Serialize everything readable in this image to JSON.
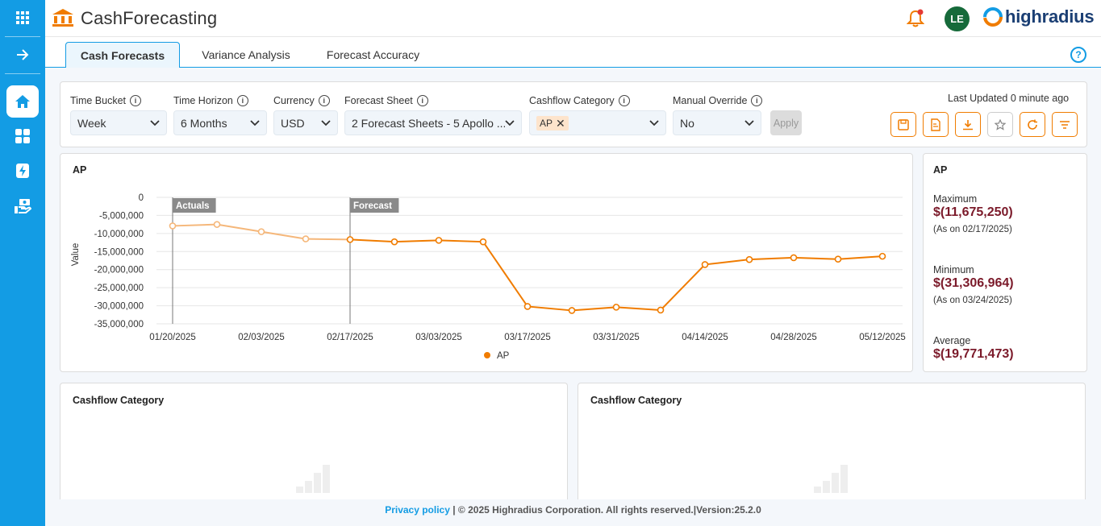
{
  "app": {
    "title": "CashForecasting",
    "brand_logo_text": "highradius",
    "avatar_initials": "LE"
  },
  "sidebar": {
    "items": [
      {
        "name": "apps-grid-icon"
      },
      {
        "name": "expand-arrow-icon"
      },
      {
        "name": "home-icon",
        "active": true
      },
      {
        "name": "dashboard-icon"
      },
      {
        "name": "bolt-icon"
      },
      {
        "name": "cash-hand-icon"
      }
    ]
  },
  "tabs": [
    {
      "label": "Cash Forecasts",
      "active": true
    },
    {
      "label": "Variance Analysis"
    },
    {
      "label": "Forecast Accuracy"
    }
  ],
  "filters": {
    "time_bucket": {
      "label": "Time Bucket",
      "value": "Week"
    },
    "time_horizon": {
      "label": "Time Horizon",
      "value": "6 Months"
    },
    "currency": {
      "label": "Currency",
      "value": "USD"
    },
    "forecast_sheet": {
      "label": "Forecast Sheet",
      "value": "2 Forecast Sheets - 5 Apollo ..."
    },
    "cashflow_category": {
      "label": "Cashflow Category",
      "chip": "AP"
    },
    "manual_override": {
      "label": "Manual Override",
      "value": "No"
    },
    "apply_label": "Apply",
    "last_updated": "Last Updated 0 minute ago"
  },
  "toolbar_icons": [
    "save-icon",
    "pdf-icon",
    "download-icon",
    "star-icon",
    "refresh-icon",
    "filter-icon"
  ],
  "chart_card": {
    "title": "AP"
  },
  "chart_data": {
    "type": "line",
    "title": "AP",
    "ylabel": "Value",
    "xlabel": "",
    "ylim": [
      -35000000,
      0
    ],
    "yticks": [
      0,
      -5000000,
      -10000000,
      -15000000,
      -20000000,
      -25000000,
      -30000000,
      -35000000
    ],
    "ytick_labels": [
      "0",
      "-5,000,000",
      "-10,000,000",
      "-15,000,000",
      "-20,000,000",
      "-25,000,000",
      "-30,000,000",
      "-35,000,000"
    ],
    "xtick_labels": [
      "01/20/2025",
      "02/03/2025",
      "02/17/2025",
      "03/03/2025",
      "03/17/2025",
      "03/31/2025",
      "04/14/2025",
      "04/28/2025",
      "05/12/2025"
    ],
    "x": [
      "01/20/2025",
      "01/27/2025",
      "02/03/2025",
      "02/10/2025",
      "02/17/2025",
      "02/24/2025",
      "03/03/2025",
      "03/10/2025",
      "03/17/2025",
      "03/24/2025",
      "03/31/2025",
      "04/07/2025",
      "04/14/2025",
      "04/21/2025",
      "04/28/2025",
      "05/05/2025",
      "05/12/2025"
    ],
    "series": [
      {
        "name": "AP",
        "color": "#f07c00",
        "actuals_color": "#f5b77a",
        "values": [
          -7900000,
          -7500000,
          -9500000,
          -11500000,
          -11675250,
          -12300000,
          -11900000,
          -12300000,
          -30200000,
          -31306964,
          -30400000,
          -31200000,
          -18600000,
          -17200000,
          -16700000,
          -17100000,
          -16300000
        ]
      }
    ],
    "markers": [
      {
        "label": "Actuals",
        "x": "01/20/2025"
      },
      {
        "label": "Forecast",
        "x": "02/17/2025"
      }
    ],
    "grid": true,
    "legend": "bottom-center"
  },
  "stats": {
    "title": "AP",
    "maximum_label": "Maximum",
    "maximum_value": "$(11,675,250)",
    "maximum_date": "(As on 02/17/2025)",
    "minimum_label": "Minimum",
    "minimum_value": "$(31,306,964)",
    "minimum_date": "(As on 03/24/2025)",
    "average_label": "Average",
    "average_value": "$(19,771,473)"
  },
  "bottom_cards": [
    {
      "title": "Cashflow Category"
    },
    {
      "title": "Cashflow Category"
    }
  ],
  "footer": {
    "privacy": "Privacy policy",
    "text": " | © 2025 Highradius Corporation. All rights reserved.|Version:25.2.0"
  }
}
